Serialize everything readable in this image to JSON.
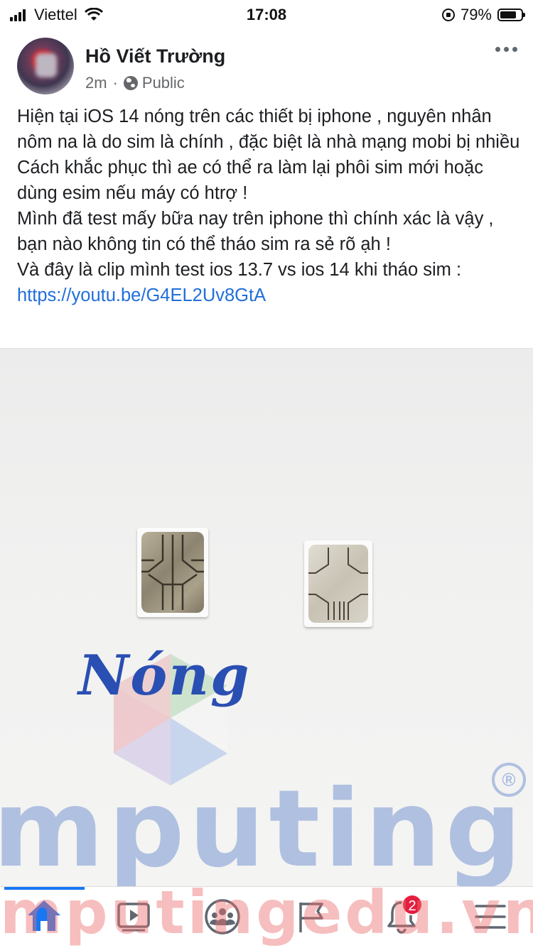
{
  "status_bar": {
    "carrier": "Viettel",
    "time": "17:08",
    "battery_percent": "79%",
    "battery_level": 0.79,
    "icons": [
      "signal-icon",
      "wifi-icon",
      "rotation-lock-icon",
      "battery-icon"
    ]
  },
  "post": {
    "author": "Hồ Viết Trường",
    "time_ago": "2m",
    "separator": "·",
    "privacy": "Public",
    "lines": [
      "Hiện tại iOS 14 nóng trên các thiết bị iphone , nguyên nhân nôm na là do sim là chính , đặc biệt là nhà mạng mobi bị nhiều",
      "Cách khắc phục thì ae có thể ra làm lại phôi sim mới hoặc dùng esim nếu máy có htrợ !",
      "Mình đã test mấy bữa nay trên iphone thì chính xác là vậy , bạn nào không tin có thể tháo sim ra sẻ rõ ạh !",
      "Và đây là clip mình test ios 13.7 vs ios 14 khi tháo sim :"
    ],
    "link": "https://youtu.be/G4EL2Uv8GtA"
  },
  "photo": {
    "handwriting": "Nóng",
    "watermark_text": "mputing",
    "watermark_reg": "®"
  },
  "bottom_nav": {
    "items": [
      "home-icon",
      "watch-icon",
      "groups-icon",
      "pages-icon",
      "notifications-icon",
      "menu-icon"
    ],
    "active": "home",
    "notification_badge": "2",
    "watermark_text": "mputingedu.vn"
  },
  "colors": {
    "accent": "#1877f2",
    "link": "#216fdb",
    "badge": "#e41e3f",
    "secondary_text": "#65676b"
  }
}
